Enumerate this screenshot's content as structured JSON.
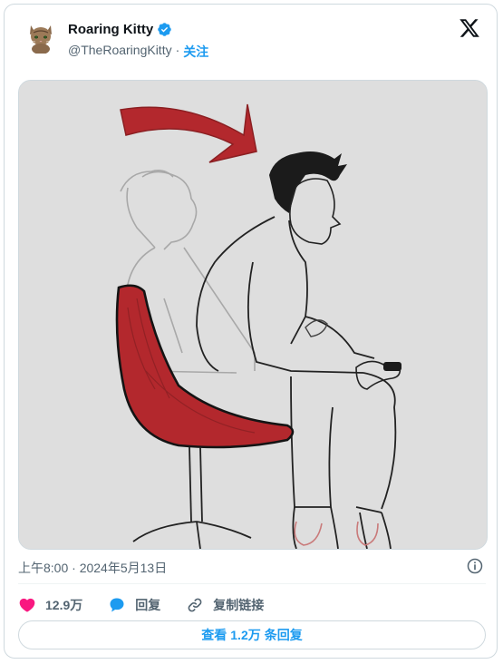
{
  "author": {
    "name": "Roaring Kitty",
    "handle": "@TheRoaringKitty",
    "separator": "·",
    "follow_label": "关注",
    "verified_color": "#1d9bf0"
  },
  "icons": {
    "avatar": "cat-avatar",
    "verified": "verified-badge-icon",
    "platform": "x-logo-icon",
    "info": "info-icon",
    "like": "heart-icon",
    "reply": "reply-bubble-icon",
    "copy_link": "link-icon"
  },
  "media": {
    "description": "pencil sketch illustration of a man leaning forward in a red gaming chair holding a controller"
  },
  "timestamp": "上午8:00 · 2024年5月13日",
  "actions": {
    "like_count": "12.9万",
    "reply_label": "回复",
    "copy_link_label": "复制链接"
  },
  "replies_button": {
    "prefix": "查看",
    "count": "1.2万",
    "suffix": "条回复"
  },
  "colors": {
    "like": "#f91880",
    "accent": "#1d9bf0",
    "muted": "#536471"
  }
}
